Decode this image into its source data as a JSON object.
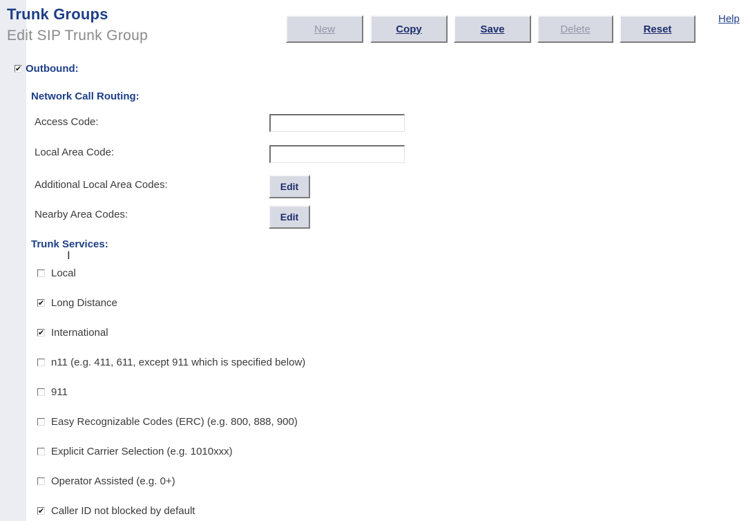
{
  "header": {
    "title": "Trunk Groups",
    "subtitle": "Edit SIP Trunk Group",
    "help_label": "Help"
  },
  "toolbar": {
    "new_label": "New",
    "copy_label": "Copy",
    "save_label": "Save",
    "delete_label": "Delete",
    "reset_label": "Reset"
  },
  "outbound": {
    "label": "Outbound:",
    "checked": true
  },
  "network_call_routing": {
    "heading": "Network Call Routing:",
    "access_code_label": "Access Code:",
    "access_code_value": "",
    "local_area_code_label": "Local Area Code:",
    "local_area_code_value": "",
    "additional_local_area_codes_label": "Additional Local Area Codes:",
    "nearby_area_codes_label": "Nearby Area Codes:",
    "edit_label": "Edit"
  },
  "trunk_services": {
    "heading": "Trunk Services:",
    "items": [
      {
        "label": "Local",
        "checked": false
      },
      {
        "label": "Long Distance",
        "checked": true
      },
      {
        "label": "International",
        "checked": true
      },
      {
        "label": "n11 (e.g. 411, 611, except 911 which is specified below)",
        "checked": false
      },
      {
        "label": "911",
        "checked": false
      },
      {
        "label": "Easy Recognizable Codes (ERC) (e.g. 800, 888, 900)",
        "checked": false
      },
      {
        "label": "Explicit Carrier Selection (e.g. 1010xxx)",
        "checked": false
      },
      {
        "label": "Operator Assisted (e.g. 0+)",
        "checked": false
      },
      {
        "label": "Caller ID not blocked by default",
        "checked": true
      }
    ]
  },
  "colors": {
    "title": "#1e3f87",
    "subtitle": "#8a8a8a",
    "button_face": "#d8dae3",
    "left_band": "#ecedf3"
  },
  "icons": {
    "checkmark": "check-icon",
    "cursor": "text-cursor-icon"
  }
}
